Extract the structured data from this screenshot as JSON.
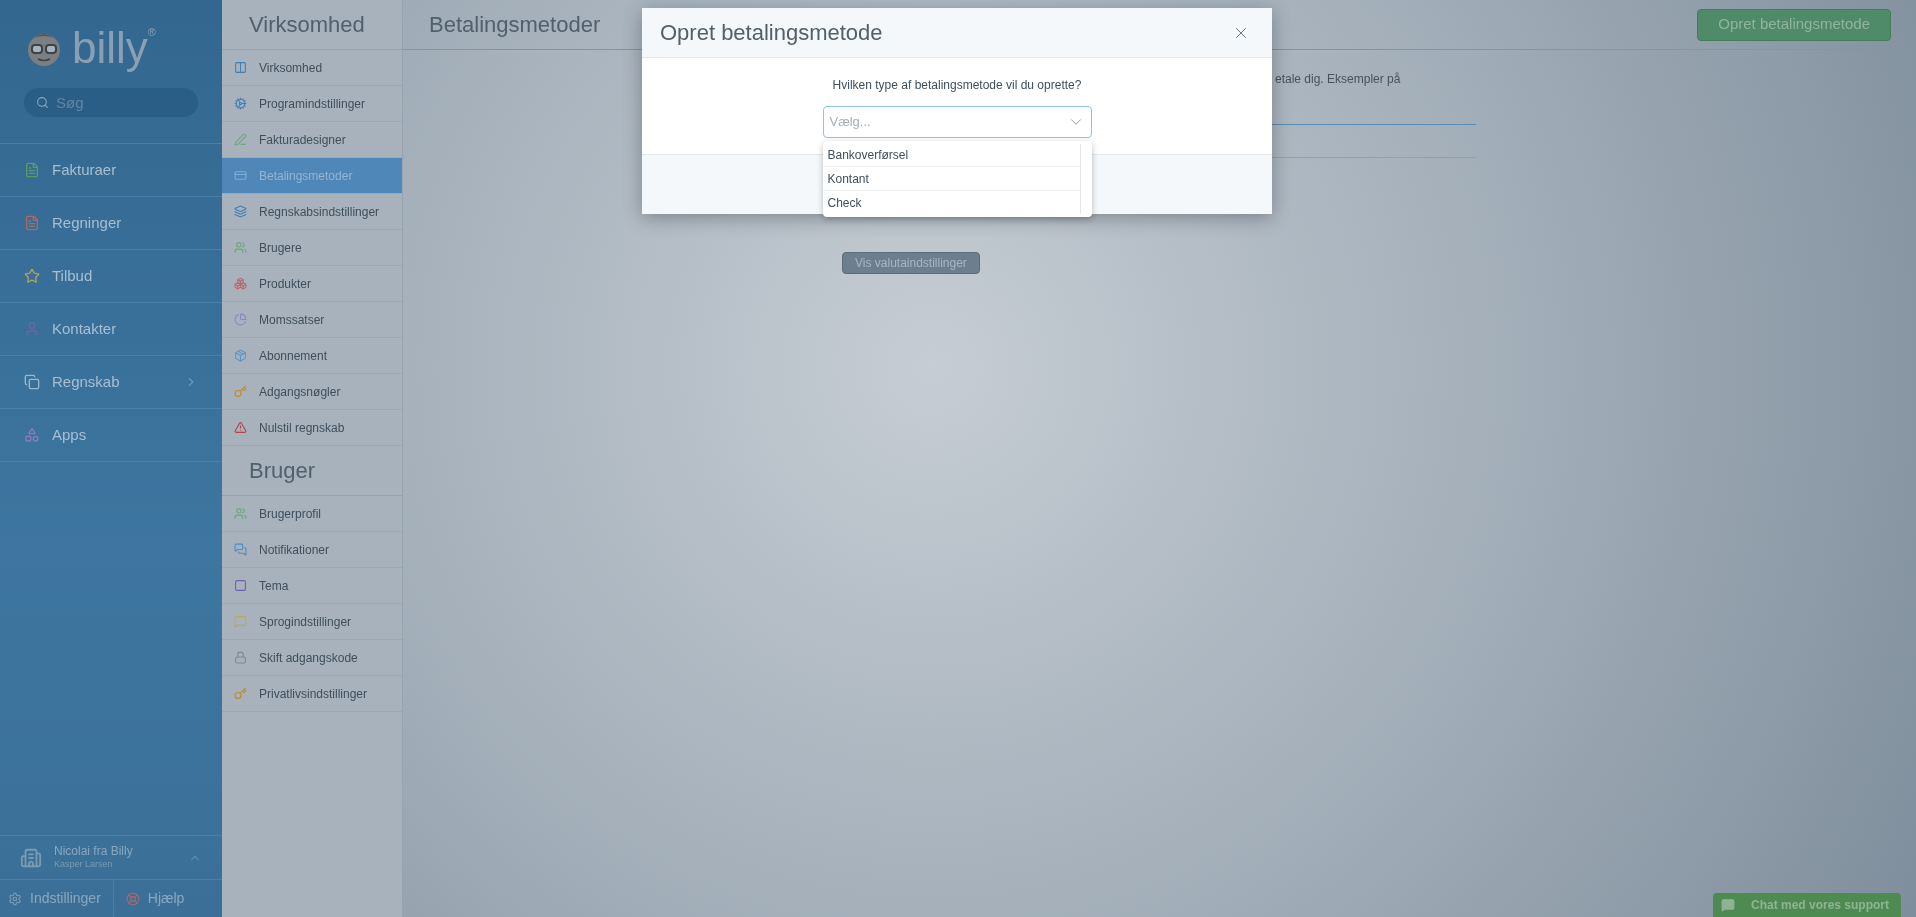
{
  "sidebar": {
    "logo": "billy",
    "logo_mark": "®",
    "search": {
      "placeholder": "Søg"
    },
    "items": [
      {
        "label": "Fakturaer",
        "expandable": false
      },
      {
        "label": "Regninger",
        "expandable": false
      },
      {
        "label": "Tilbud",
        "expandable": false
      },
      {
        "label": "Kontakter",
        "expandable": false
      },
      {
        "label": "Regnskab",
        "expandable": true
      },
      {
        "label": "Apps",
        "expandable": false
      }
    ],
    "user": {
      "name": "Nicolai fra Billy",
      "subtitle": "Kasper Larsen"
    },
    "footer": [
      "Indstillinger",
      "Hjælp"
    ]
  },
  "settings_nav": {
    "sections": [
      {
        "title": "Virksomhed",
        "items": [
          {
            "label": "Virksomhed",
            "selected": false
          },
          {
            "label": "Programindstillinger",
            "selected": false
          },
          {
            "label": "Fakturadesigner",
            "selected": false
          },
          {
            "label": "Betalingsmetoder",
            "selected": true
          },
          {
            "label": "Regnskabsindstillinger",
            "selected": false
          },
          {
            "label": "Brugere",
            "selected": false
          },
          {
            "label": "Produkter",
            "selected": false
          },
          {
            "label": "Momssatser",
            "selected": false
          },
          {
            "label": "Abonnement",
            "selected": false
          },
          {
            "label": "Adgangsnøgler",
            "selected": false
          },
          {
            "label": "Nulstil regnskab",
            "selected": false
          }
        ]
      },
      {
        "title": "Bruger",
        "items": [
          {
            "label": "Brugerprofil",
            "selected": false
          },
          {
            "label": "Notifikationer",
            "selected": false
          },
          {
            "label": "Tema",
            "selected": false
          },
          {
            "label": "Sprogindstillinger",
            "selected": false
          },
          {
            "label": "Skift adgangskode",
            "selected": false
          },
          {
            "label": "Privatlivsindstillinger",
            "selected": false
          }
        ]
      }
    ]
  },
  "page": {
    "title": "Betalingsmetoder",
    "create_button": "Opret betalingsmetode",
    "description_fragment": "etale dig. Eksempler på",
    "currency_button": "Vis valutaindstillinger"
  },
  "modal": {
    "title": "Opret betalingsmetode",
    "question": "Hvilken type af betalingsmetode vil du oprette?",
    "select": {
      "placeholder": "Vælg...",
      "expanded": true,
      "options": [
        "Bankoverførsel",
        "Kontant",
        "Check"
      ]
    }
  },
  "chat_button": "Chat med vores support"
}
